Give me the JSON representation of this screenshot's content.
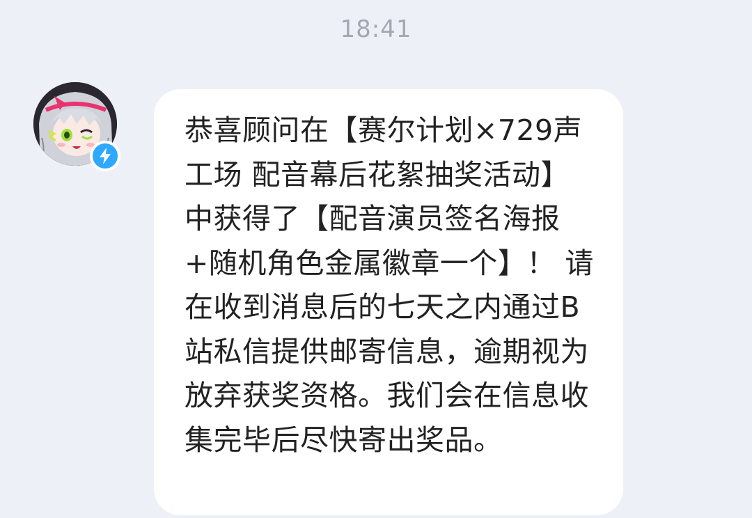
{
  "chat": {
    "timestamp": "18:41",
    "message": {
      "sender_avatar": "anime-girl-avatar",
      "verified_icon": "lightning-bolt-icon",
      "verified_color": "#2fa8ff",
      "text": "恭喜顾问在【赛尔计划×729声工场 配音幕后花絮抽奖活动】中获得了【配音演员签名海报+随机角色金属徽章一个】！ 请在收到消息后的七天之内通过B站私信提供邮寄信息，逾期视为放弃获奖资格。我们会在信息收集完毕后尽快寄出奖品。"
    }
  }
}
